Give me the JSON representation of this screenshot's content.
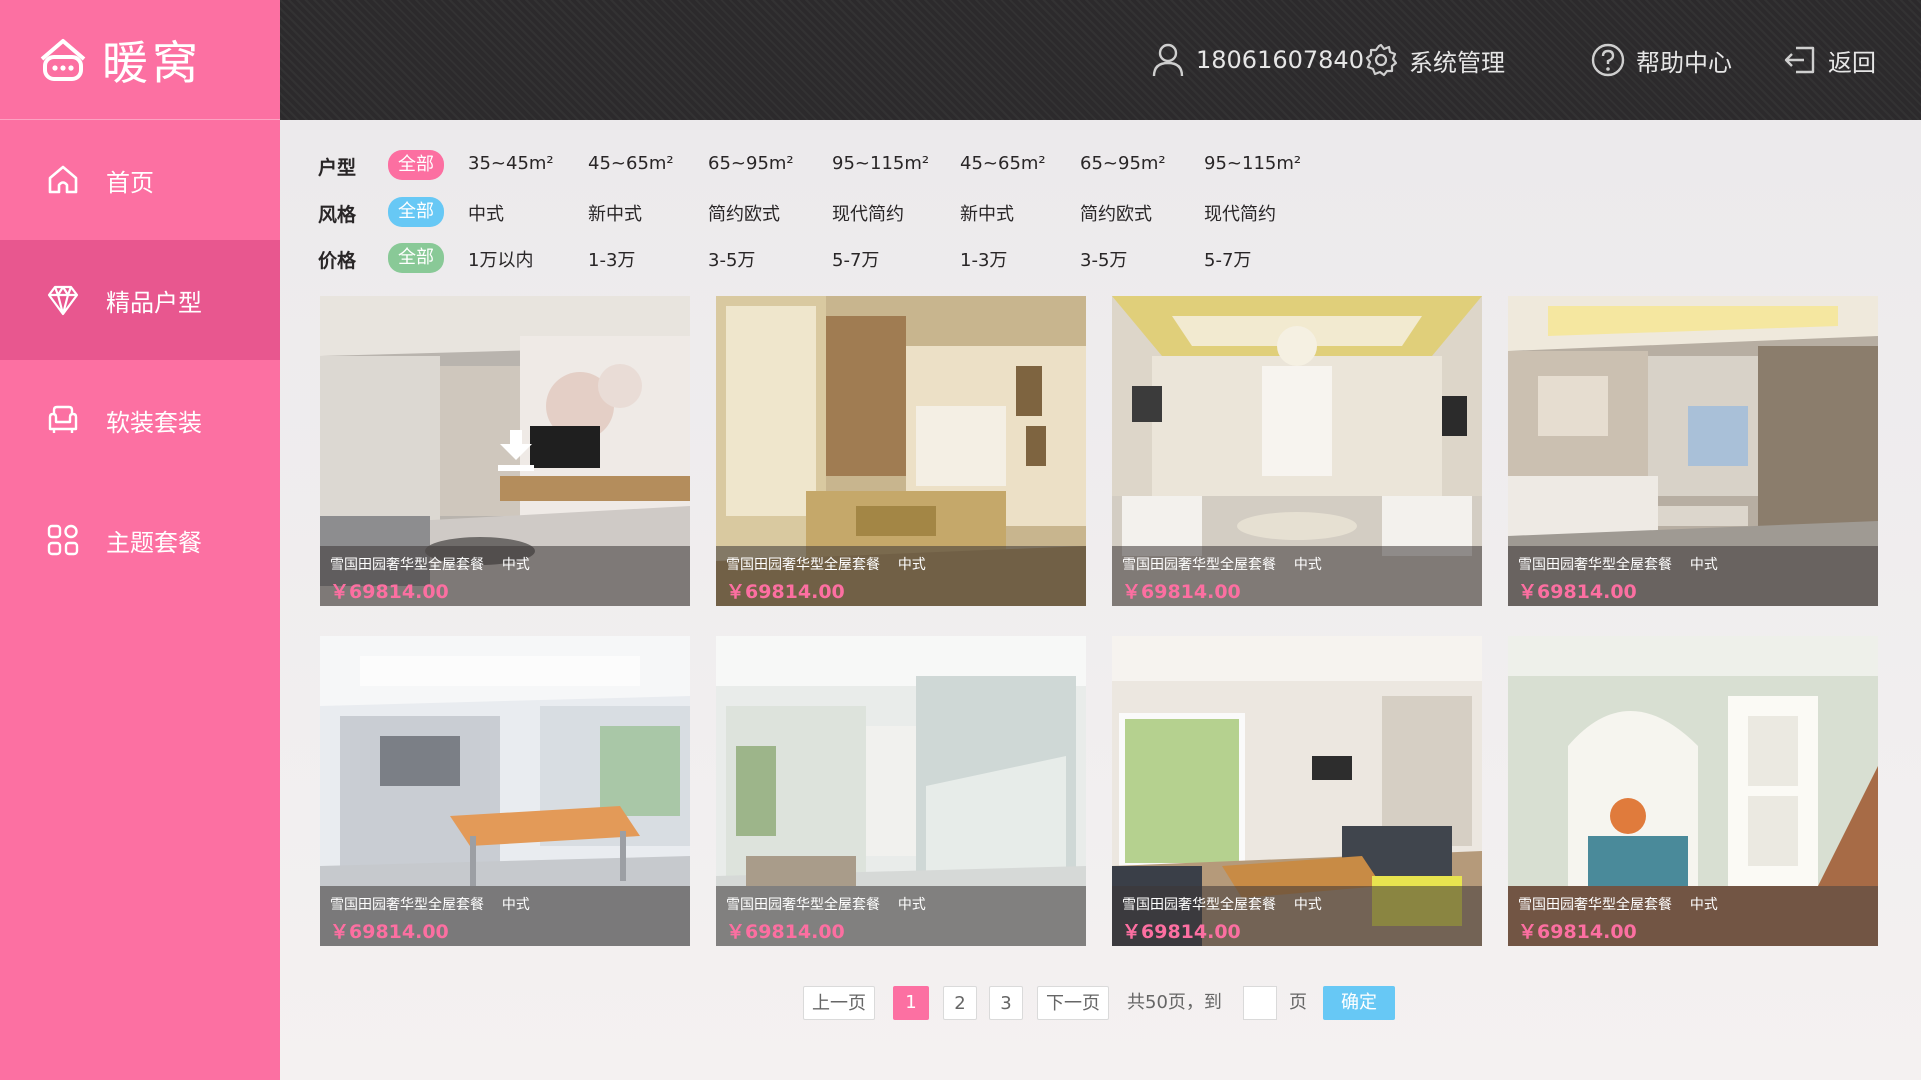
{
  "brand": {
    "logo_text": "暖窝",
    "color": "#fc70a2"
  },
  "sidebar": {
    "items": [
      {
        "label": "首页",
        "icon": "home-icon",
        "active": false
      },
      {
        "label": "精品户型",
        "icon": "diamond-icon",
        "active": true
      },
      {
        "label": "软装套装",
        "icon": "sofa-icon",
        "active": false
      },
      {
        "label": "主题套餐",
        "icon": "grid-icon",
        "active": false
      }
    ]
  },
  "header": {
    "phone": "18061607840",
    "system_label": "系统管理",
    "help_label": "帮助中心",
    "back_label": "返回"
  },
  "filters": {
    "huxing": {
      "label": "户型",
      "all": "全部",
      "options": [
        "35~45m²",
        "45~65m²",
        "65~95m²",
        "95~115m²",
        "45~65m²",
        "65~95m²",
        "95~115m²"
      ]
    },
    "fengge": {
      "label": "风格",
      "all": "全部",
      "options": [
        "中式",
        "新中式",
        "简约欧式",
        "现代简约",
        "新中式",
        "简约欧式",
        "现代简约"
      ]
    },
    "jiage": {
      "label": "价格",
      "all": "全部",
      "options": [
        "1万以内",
        "1-3万",
        "3-5万",
        "5-7万",
        "1-3万",
        "3-5万",
        "5-7万"
      ]
    },
    "colors": {
      "huxing_all": "#fc6fa1",
      "fengge_all": "#67c8f5",
      "jiage_all": "#89c997"
    }
  },
  "cards": [
    {
      "name": "雪国田园奢华型全屋套餐",
      "style": "中式",
      "price": "￥69814.00"
    },
    {
      "name": "雪国田园奢华型全屋套餐",
      "style": "中式",
      "price": "￥69814.00"
    },
    {
      "name": "雪国田园奢华型全屋套餐",
      "style": "中式",
      "price": "￥69814.00"
    },
    {
      "name": "雪国田园奢华型全屋套餐",
      "style": "中式",
      "price": "￥69814.00"
    },
    {
      "name": "雪国田园奢华型全屋套餐",
      "style": "中式",
      "price": "￥69814.00"
    },
    {
      "name": "雪国田园奢华型全屋套餐",
      "style": "中式",
      "price": "￥69814.00"
    },
    {
      "name": "雪国田园奢华型全屋套餐",
      "style": "中式",
      "price": "￥69814.00"
    },
    {
      "name": "雪国田园奢华型全屋套餐",
      "style": "中式",
      "price": "￥69814.00"
    }
  ],
  "pagination": {
    "prev": "上一页",
    "pages": [
      "1",
      "2",
      "3"
    ],
    "current": "1",
    "next": "下一页",
    "total_text": "共50页，到",
    "page_unit": "页",
    "confirm": "确定",
    "colors": {
      "current": "#fc70a2",
      "confirm": "#67c8f5"
    }
  }
}
